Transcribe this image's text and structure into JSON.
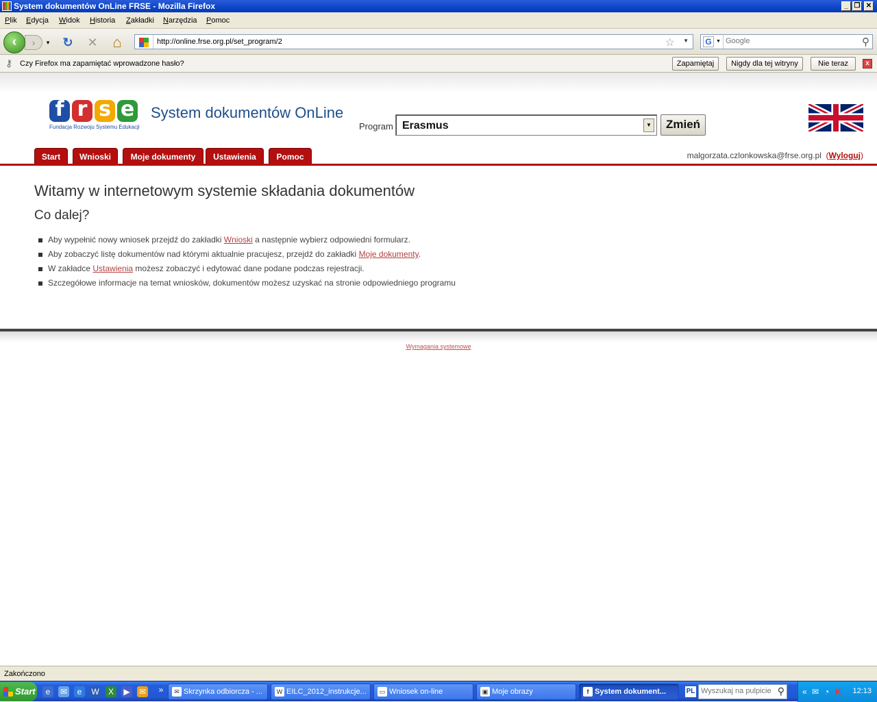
{
  "window": {
    "title": "System dokumentów OnLine FRSE - Mozilla Firefox",
    "minimize": "_",
    "restore": "❐",
    "close": "✕"
  },
  "menu": [
    "Plik",
    "Edycja",
    "Widok",
    "Historia",
    "Zakładki",
    "Narzędzia",
    "Pomoc"
  ],
  "nav": {
    "back": "‹",
    "forward": "›",
    "reload": "↻",
    "stop": "✕",
    "home": "⌂",
    "url": "http://online.frse.org.pl/set_program/2",
    "star": "☆",
    "search_engine": "G",
    "search_placeholder": "Google"
  },
  "notification": {
    "message": "Czy Firefox ma zapamiętać wprowadzone hasło?",
    "remember": "Zapamiętaj",
    "never": "Nigdy dla tej witryny",
    "not_now": "Nie teraz",
    "close": "x"
  },
  "site": {
    "logo_letters": [
      "f",
      "r",
      "s",
      "e"
    ],
    "logo_colors": [
      "#1f4fa5",
      "#d32f2f",
      "#f2a900",
      "#2e9a3a"
    ],
    "logo_subtitle": "Fundacja Rozwoju Systemu Edukacji",
    "title": "System dokumentów OnLine",
    "program_label": "Program",
    "program_selected": "Erasmus",
    "change_button": "Zmień",
    "tabs": [
      "Start",
      "Wnioski",
      "Moje dokumenty",
      "Ustawienia",
      "Pomoc"
    ],
    "user_email": "malgorzata.czlonkowska@frse.org.pl",
    "logout": "Wyloguj",
    "welcome": "Witamy w internetowym systemie składania dokumentów",
    "next_heading": "Co dalej?",
    "info": [
      {
        "pre": "Aby wypełnić nowy wniosek przejdź do zakładki ",
        "link": "Wnioski",
        "post": " a następnie wybierz odpowiedni formularz."
      },
      {
        "pre": "Aby zobaczyć listę dokumentów nad którymi aktualnie pracujesz, przejdź do zakładki ",
        "link": "Moje dokumenty",
        "post": "."
      },
      {
        "pre": "W zakładce ",
        "link": "Ustawienia",
        "post": " możesz zobaczyć i edytować dane podane podczas rejestracji."
      },
      {
        "pre": "Szczegółowe informacje na temat wniosków, dokumentów możesz uzyskać na stronie odpowiedniego programu",
        "link": "",
        "post": ""
      }
    ],
    "requirements_link": "Wymagania systemowe",
    "accent_color": "#b30f0f"
  },
  "status": "Zakończono",
  "taskbar": {
    "start": "Start",
    "overflow": "»",
    "tasks": [
      {
        "label": "Skrzynka odbiorcza - ...",
        "icon": "✉"
      },
      {
        "label": "EILC_2012_instrukcje...",
        "icon": "W"
      },
      {
        "label": "Wniosek on-line",
        "icon": "▭"
      },
      {
        "label": "Moje obrazy",
        "icon": "▣"
      },
      {
        "label": "System dokument...",
        "icon": "f"
      }
    ],
    "lang": "PL",
    "desktop_search_placeholder": "Wyszukaj na pulpicie",
    "tray_expand": "«",
    "clock": "12:13"
  }
}
